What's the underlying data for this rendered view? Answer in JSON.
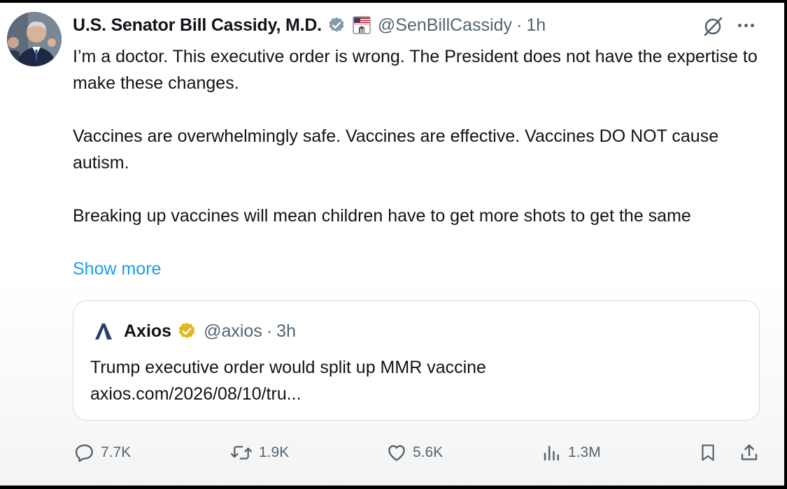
{
  "author": {
    "name": "U.S. Senator Bill Cassidy, M.D.",
    "handle": "@SenBillCassidy",
    "separator": "·",
    "time": "1h"
  },
  "post": {
    "paragraphs": [
      "I’m a doctor. This executive order is wrong. The President does not have the expertise to make these changes.",
      "Vaccines are overwhelmingly safe. Vaccines are effective. Vaccines DO NOT cause autism.",
      "Breaking up vaccines will mean children have to get more shots to get the same"
    ],
    "show_more": "Show more"
  },
  "quote": {
    "name": "Axios",
    "handle": "@axios",
    "separator": "·",
    "time": "3h",
    "text": "Trump executive order would split up MMR vaccine",
    "link": "axios.com/2026/08/10/tru..."
  },
  "actions": {
    "replies": "7.7K",
    "reposts": "1.9K",
    "likes": "5.6K",
    "views": "1.3M"
  },
  "colors": {
    "text": "#0f1419",
    "secondary": "#536471",
    "link": "#1d9bf0",
    "gov_badge": "#829aab",
    "gold_badge": "#e2b719"
  },
  "icons": [
    "gov-verified-badge-icon",
    "us-capitol-flag-icon",
    "grok-icon",
    "more-icon",
    "axios-logo-icon",
    "gold-verified-badge-icon",
    "reply-icon",
    "repost-icon",
    "like-icon",
    "views-icon",
    "bookmark-icon",
    "share-icon"
  ]
}
